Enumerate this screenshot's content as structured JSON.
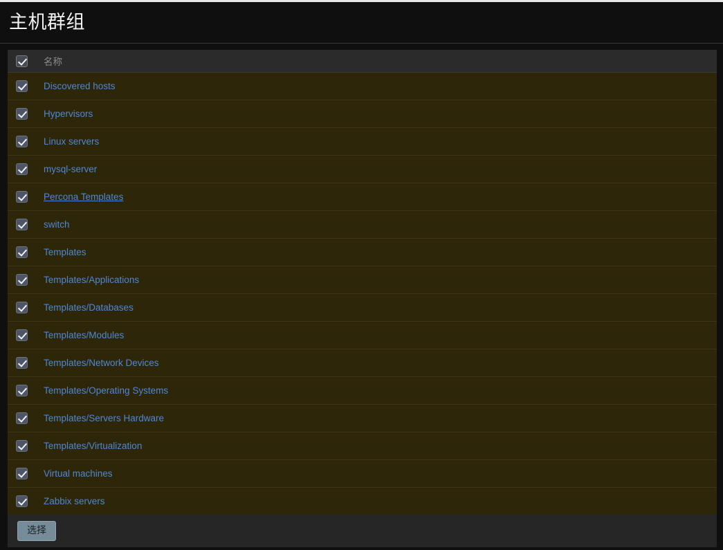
{
  "window": {
    "title": "主机群组"
  },
  "table": {
    "header": {
      "select_all_icon": "checkbox-checked-icon",
      "name_column_label": "名称"
    },
    "rows": [
      {
        "name": "Discovered hosts",
        "checked": true,
        "hovered": false
      },
      {
        "name": "Hypervisors",
        "checked": true,
        "hovered": false
      },
      {
        "name": "Linux servers",
        "checked": true,
        "hovered": false
      },
      {
        "name": "mysql-server",
        "checked": true,
        "hovered": false
      },
      {
        "name": "Percona Templates",
        "checked": true,
        "hovered": true
      },
      {
        "name": "switch",
        "checked": true,
        "hovered": false
      },
      {
        "name": "Templates",
        "checked": true,
        "hovered": false
      },
      {
        "name": "Templates/Applications",
        "checked": true,
        "hovered": false
      },
      {
        "name": "Templates/Databases",
        "checked": true,
        "hovered": false
      },
      {
        "name": "Templates/Modules",
        "checked": true,
        "hovered": false
      },
      {
        "name": "Templates/Network Devices",
        "checked": true,
        "hovered": false
      },
      {
        "name": "Templates/Operating Systems",
        "checked": true,
        "hovered": false
      },
      {
        "name": "Templates/Servers Hardware",
        "checked": true,
        "hovered": false
      },
      {
        "name": "Templates/Virtualization",
        "checked": true,
        "hovered": false
      },
      {
        "name": "Virtual machines",
        "checked": true,
        "hovered": false
      },
      {
        "name": "Zabbix servers",
        "checked": true,
        "hovered": false
      }
    ]
  },
  "footer": {
    "select_button_label": "选择"
  },
  "colors": {
    "page_background": "#0f0f0f",
    "row_background": "#2d2608",
    "header_background": "#2b2b2b",
    "link": "#4e88d4",
    "button_background": "#768d99",
    "title_text": "#f2f2f2",
    "header_text": "#8b8b8b"
  }
}
